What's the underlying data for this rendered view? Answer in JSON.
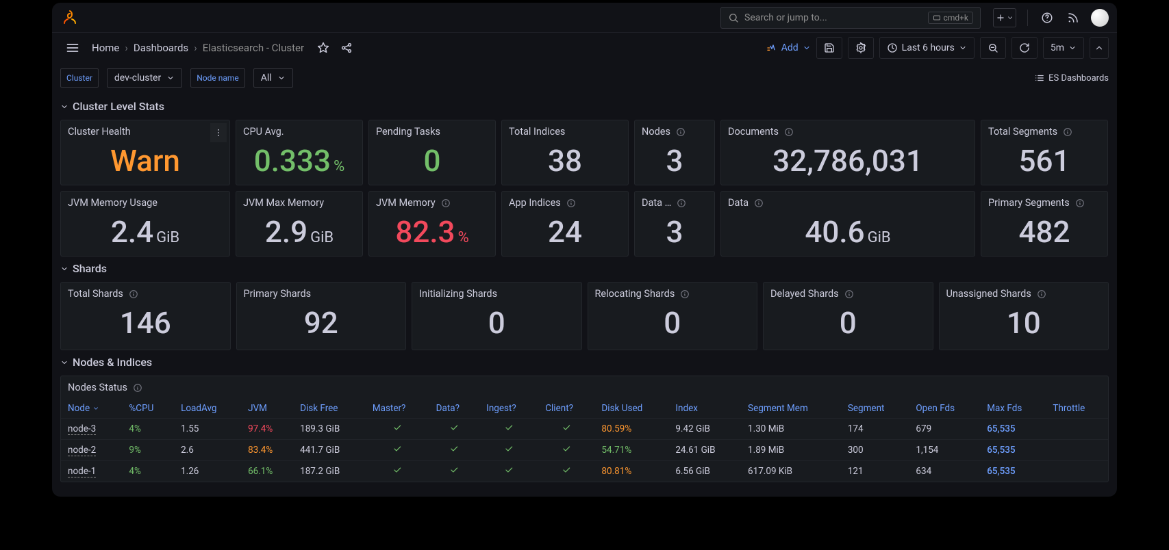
{
  "search": {
    "placeholder": "Search or jump to...",
    "kbd": "cmd+k"
  },
  "breadcrumb": {
    "home": "Home",
    "dashboards": "Dashboards",
    "current": "Elasticsearch - Cluster"
  },
  "toolbar": {
    "add": "Add",
    "time_range": "Last 6 hours",
    "refresh_interval": "5m"
  },
  "variables": {
    "cluster_label": "Cluster",
    "cluster_value": "dev-cluster",
    "node_label": "Node name",
    "node_value": "All",
    "links": "ES Dashboards"
  },
  "sections": {
    "cluster": "Cluster Level Stats",
    "shards": "Shards",
    "nodes": "Nodes & Indices"
  },
  "stats_row1": [
    {
      "title": "Cluster Health",
      "value": "Warn",
      "cls": "orange"
    },
    {
      "title": "CPU Avg.",
      "value": "0.333",
      "unit": "%",
      "cls": "green"
    },
    {
      "title": "Pending Tasks",
      "value": "0",
      "cls": "green"
    },
    {
      "title": "Total Indices",
      "value": "38",
      "cls": "white"
    },
    {
      "title": "Nodes",
      "value": "3",
      "cls": "white",
      "info": true
    },
    {
      "title": "Documents",
      "value": "32,786,031",
      "cls": "white",
      "info": true
    },
    {
      "title": "Total Segments",
      "value": "561",
      "cls": "white",
      "info": true
    }
  ],
  "stats_row2": [
    {
      "title": "JVM Memory Usage",
      "value": "2.4",
      "unit": "GiB",
      "cls": "white"
    },
    {
      "title": "JVM Max Memory",
      "value": "2.9",
      "unit": "GiB",
      "cls": "white"
    },
    {
      "title": "JVM Memory",
      "value": "82.3",
      "unit": "%",
      "cls": "red",
      "info": true
    },
    {
      "title": "App Indices",
      "value": "24",
      "cls": "white",
      "info": true
    },
    {
      "title": "Data …",
      "value": "3",
      "cls": "white",
      "info": true
    },
    {
      "title": "Data",
      "value": "40.6",
      "unit": "GiB",
      "cls": "white",
      "info": true
    },
    {
      "title": "Primary Segments",
      "value": "482",
      "cls": "white",
      "info": true
    }
  ],
  "shards_row": [
    {
      "title": "Total Shards",
      "value": "146",
      "info": true
    },
    {
      "title": "Primary Shards",
      "value": "92"
    },
    {
      "title": "Initializing Shards",
      "value": "0"
    },
    {
      "title": "Relocating Shards",
      "value": "0",
      "info": true
    },
    {
      "title": "Delayed Shards",
      "value": "0",
      "info": true
    },
    {
      "title": "Unassigned Shards",
      "value": "10",
      "info": true
    }
  ],
  "table": {
    "title": "Nodes Status",
    "headers": [
      "Node",
      "%CPU",
      "LoadAvg",
      "JVM",
      "Disk Free",
      "Master?",
      "Data?",
      "Ingest?",
      "Client?",
      "Disk Used",
      "Index",
      "Segment Mem",
      "Segment",
      "Open Fds",
      "Max Fds",
      "Throttle"
    ],
    "rows": [
      {
        "node": "node-3",
        "cpu": "4%",
        "load": "1.55",
        "jvm": "97.4%",
        "jvm_cls": "red",
        "diskfree": "189.3 GiB",
        "diskused": "80.59%",
        "du_cls": "orange",
        "index": "9.42 GiB",
        "segmem": "1.30 MiB",
        "seg": "174",
        "open": "679",
        "max": "65,535"
      },
      {
        "node": "node-2",
        "cpu": "9%",
        "load": "2.6",
        "jvm": "83.4%",
        "jvm_cls": "orange",
        "diskfree": "441.7 GiB",
        "diskused": "54.71%",
        "du_cls": "green",
        "index": "24.61 GiB",
        "segmem": "1.89 MiB",
        "seg": "300",
        "open": "1,154",
        "max": "65,535"
      },
      {
        "node": "node-1",
        "cpu": "4%",
        "load": "1.26",
        "jvm": "66.1%",
        "jvm_cls": "green",
        "diskfree": "187.2 GiB",
        "diskused": "80.81%",
        "du_cls": "orange",
        "index": "6.56 GiB",
        "segmem": "617.09 KiB",
        "seg": "121",
        "open": "634",
        "max": "65,535"
      }
    ]
  }
}
